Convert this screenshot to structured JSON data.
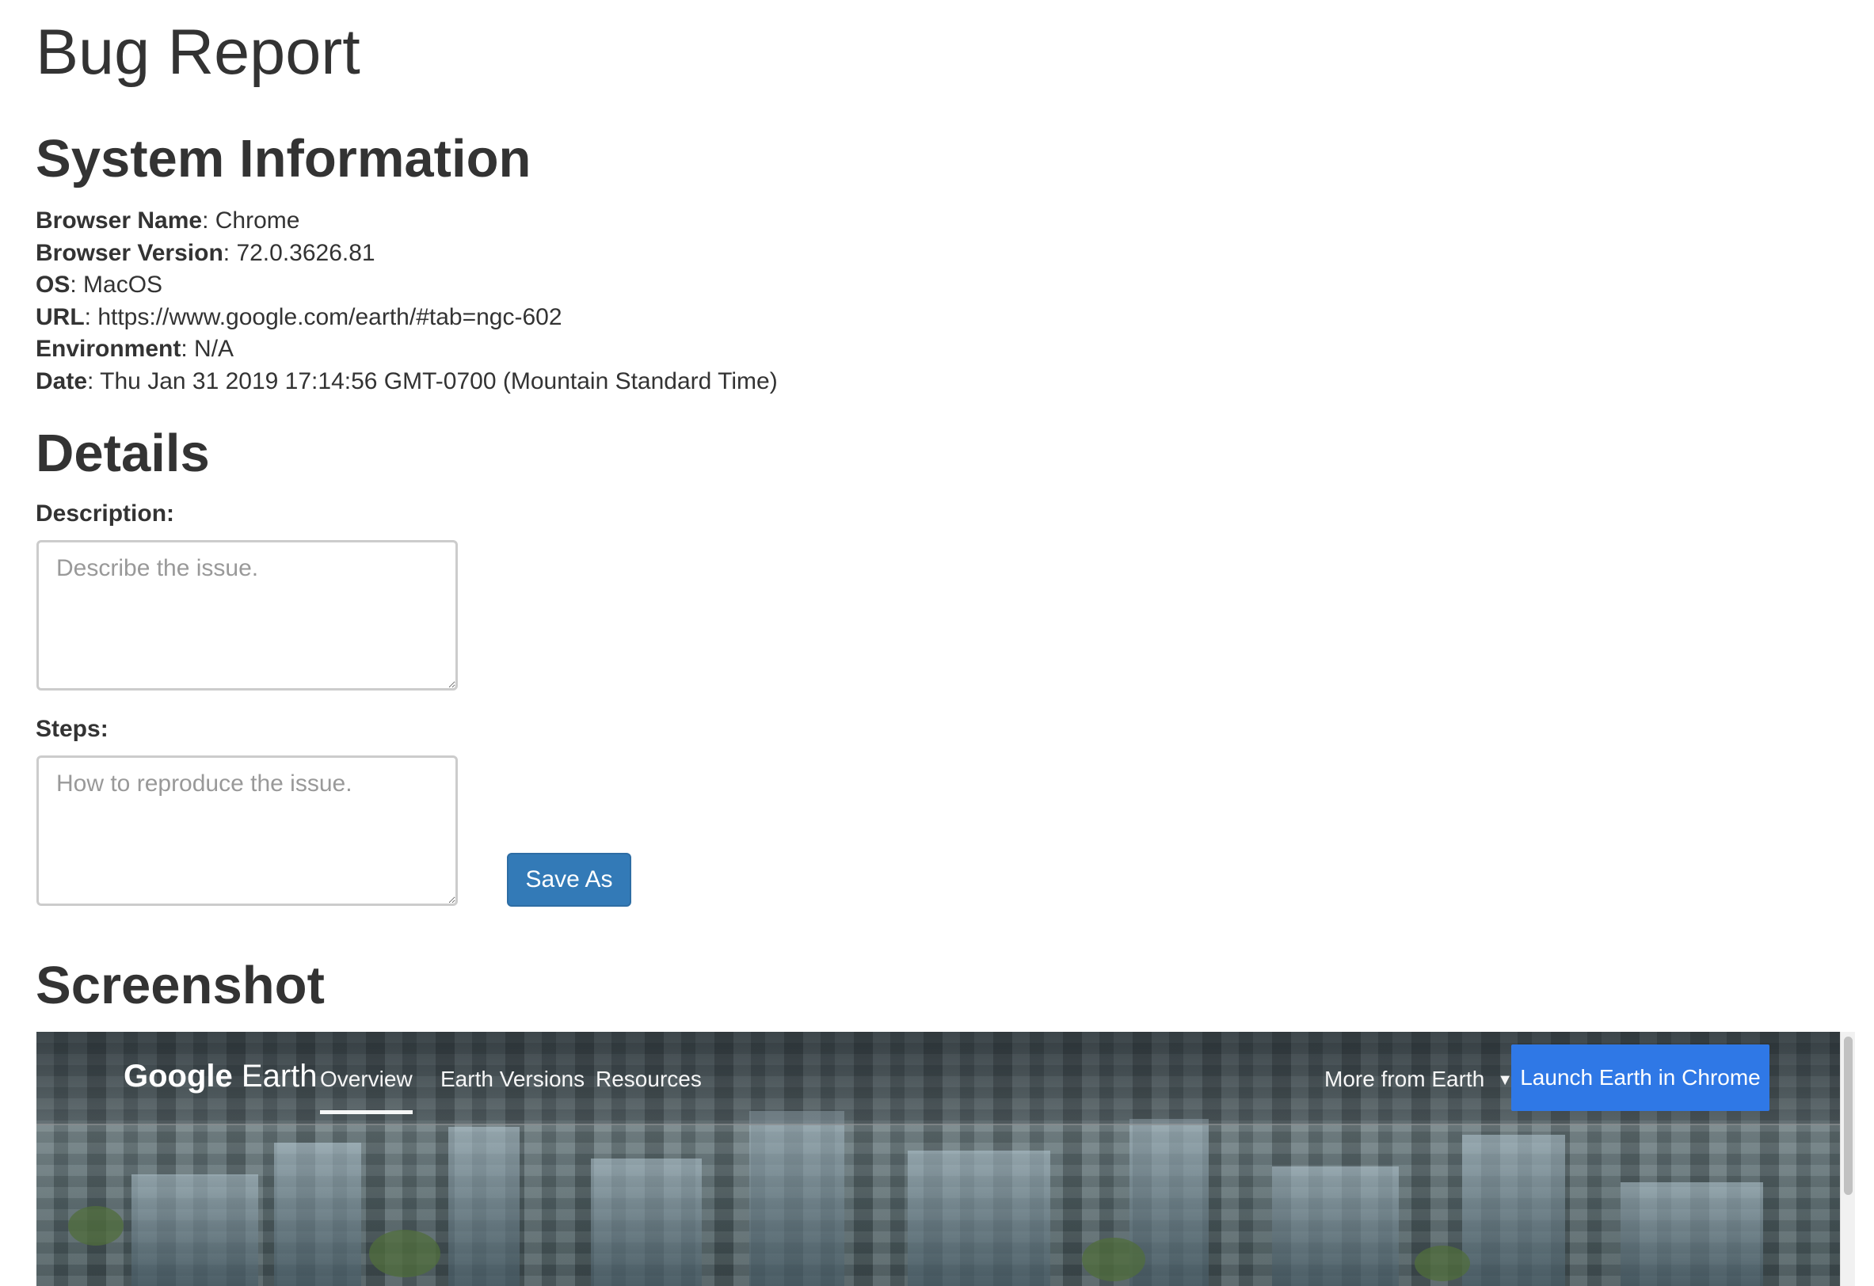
{
  "page": {
    "title": "Bug Report"
  },
  "system_information": {
    "heading": "System Information",
    "fields": [
      {
        "label": "Browser Name",
        "value": "Chrome"
      },
      {
        "label": "Browser Version",
        "value": "72.0.3626.81"
      },
      {
        "label": "OS",
        "value": "MacOS"
      },
      {
        "label": "URL",
        "value": "https://www.google.com/earth/#tab=ngc-602"
      },
      {
        "label": "Environment",
        "value": "N/A"
      },
      {
        "label": "Date",
        "value": "Thu Jan 31 2019 17:14:56 GMT-0700 (Mountain Standard Time)"
      }
    ]
  },
  "details": {
    "heading": "Details",
    "description": {
      "label": "Description:",
      "placeholder": "Describe the issue.",
      "value": ""
    },
    "steps": {
      "label": "Steps:",
      "placeholder": "How to reproduce the issue.",
      "value": ""
    },
    "save_label": "Save As"
  },
  "screenshot": {
    "heading": "Screenshot",
    "preview": {
      "logo_google": "Google",
      "logo_earth": "Earth",
      "nav": {
        "overview": "Overview",
        "earth_versions": "Earth Versions",
        "resources": "Resources",
        "more_from_earth": "More from Earth"
      },
      "caret_icon": "▼",
      "launch_label": "Launch Earth in Chrome",
      "accent_color": "#2f78e6"
    }
  },
  "colors": {
    "primary_button": "#337ab7",
    "text": "#333333"
  }
}
